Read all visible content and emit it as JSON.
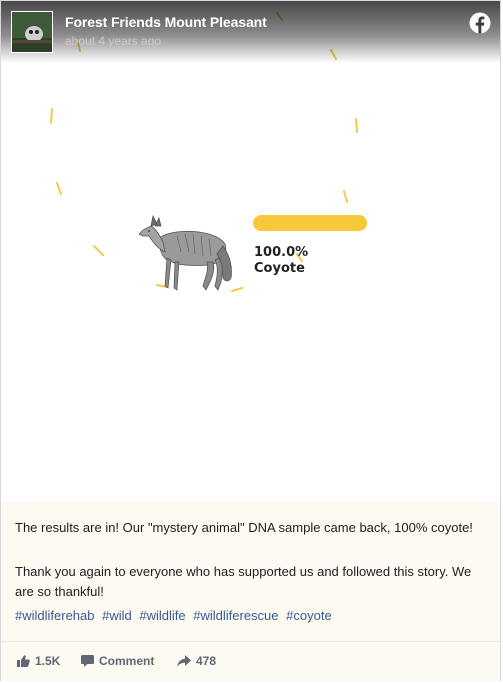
{
  "post": {
    "page_name": "Forest Friends Mount Pleasant",
    "time": "about 4 years ago",
    "logo_icon": "facebook-icon",
    "avatar_icon": "lemur-avatar"
  },
  "media": {
    "result_percent": "100.0%",
    "result_animal": "Coyote",
    "result_fraction": 1.0,
    "accent_color": "#f5c93a",
    "animal_icon": "coyote-illustration"
  },
  "caption": {
    "paragraph_1": "The results are in! Our \"mystery animal\" DNA sample came back, 100% coyote!",
    "paragraph_2": "Thank you again to everyone who has supported us and followed this story. We are so thankful!",
    "hashtags": [
      "#wildliferehab",
      "#wild",
      "#wildlife",
      "#wildliferescue",
      "#coyote"
    ],
    "link_color": "#385898"
  },
  "footer": {
    "likes": "1.5K",
    "comment_label": "Comment",
    "shares": "478",
    "like_icon": "thumbs-up-icon",
    "comment_icon": "comment-icon",
    "share_icon": "share-arrow-icon"
  }
}
